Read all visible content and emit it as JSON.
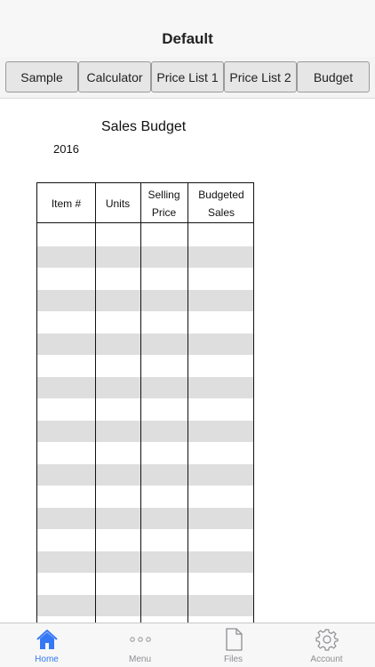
{
  "nav": {
    "title": "Default"
  },
  "segments": [
    "Sample",
    "Calculator",
    "Price List 1",
    "Price List 2",
    "Budget"
  ],
  "sheet": {
    "title": "Sales Budget",
    "year": "2016",
    "headers": [
      {
        "line1": "Item #",
        "line2": ""
      },
      {
        "line1": "Units",
        "line2": ""
      },
      {
        "line1": "Selling",
        "line2": "Price"
      },
      {
        "line1": "Budgeted",
        "line2": "Sales"
      }
    ]
  },
  "tabbar": {
    "items": [
      {
        "label": "Home",
        "icon": "home-icon",
        "active": true
      },
      {
        "label": "Menu",
        "icon": "dots-icon",
        "active": false
      },
      {
        "label": "Files",
        "icon": "file-icon",
        "active": false
      },
      {
        "label": "Account",
        "icon": "gear-icon",
        "active": false
      }
    ]
  },
  "colors": {
    "accent": "#3478f6",
    "stripe": "#dedede",
    "inactive": "#8e8e93"
  }
}
